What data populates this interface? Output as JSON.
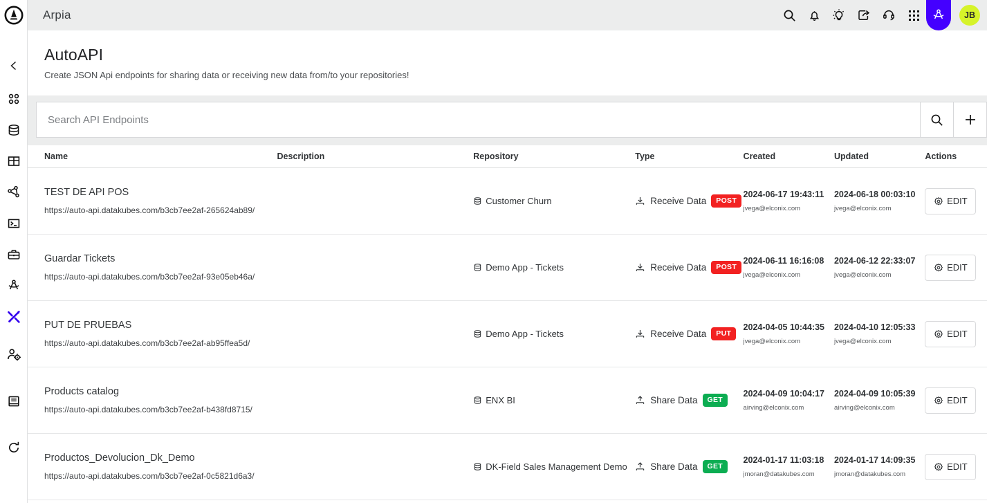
{
  "brand": {
    "logo_name": "arpia-logo",
    "accent": "#4400ff",
    "avatar_bg": "#d6f32a"
  },
  "topbar": {
    "title": "Arpia",
    "icons": [
      {
        "name": "search-icon"
      },
      {
        "name": "bell-icon"
      },
      {
        "name": "lightbulb-idea-icon"
      },
      {
        "name": "share-icon"
      },
      {
        "name": "headset-support-icon"
      },
      {
        "name": "apps-grid-icon"
      },
      {
        "name": "arpia-tools-icon",
        "active": true
      }
    ],
    "avatar_initials": "JB"
  },
  "sidebar": {
    "collapse_icon": "chevron-left-icon",
    "items": [
      {
        "name": "sidebar-item-dashboard",
        "icon": "four-dots-icon"
      },
      {
        "name": "sidebar-item-databases",
        "icon": "database-icon"
      },
      {
        "name": "sidebar-item-tables",
        "icon": "table-grid-icon"
      },
      {
        "name": "sidebar-item-pipelines",
        "icon": "network-share-icon"
      },
      {
        "name": "sidebar-item-terminal",
        "icon": "terminal-icon"
      },
      {
        "name": "sidebar-item-toolbox",
        "icon": "briefcase-icon"
      },
      {
        "name": "sidebar-item-autoapi",
        "icon": "arpia-compass-icon"
      },
      {
        "name": "sidebar-item-tools",
        "icon": "wrench-screwdriver-icon",
        "active": true
      },
      {
        "name": "sidebar-item-user-admin",
        "icon": "user-settings-icon"
      },
      {
        "name": "sidebar-item-docs",
        "icon": "book-icon"
      },
      {
        "name": "sidebar-item-refresh",
        "icon": "refresh-icon"
      }
    ]
  },
  "page": {
    "title": "AutoAPI",
    "subtitle": "Create JSON Api endpoints for sharing data or receiving new data from/to your repositories!"
  },
  "search": {
    "placeholder": "Search API Endpoints",
    "value": "",
    "search_icon": "search-icon",
    "add_icon": "plus-icon"
  },
  "table": {
    "columns": [
      {
        "key": "name",
        "label": "Name"
      },
      {
        "key": "description",
        "label": "Description"
      },
      {
        "key": "repository",
        "label": "Repository"
      },
      {
        "key": "type",
        "label": "Type"
      },
      {
        "key": "created",
        "label": "Created"
      },
      {
        "key": "updated",
        "label": "Updated"
      },
      {
        "key": "actions",
        "label": "Actions"
      }
    ],
    "edit_label": "EDIT",
    "rows": [
      {
        "name": "TEST DE API POS",
        "url": "https://auto-api.datakubes.com/b3cb7ee2af-265624ab89/",
        "description": "",
        "repository": "Customer Churn",
        "type_label": "Receive Data",
        "type_icon": "receive-data-icon",
        "method": "POST",
        "method_color": "#f22121",
        "created_at": "2024-06-17 19:43:11",
        "created_by": "jvega@elconix.com",
        "updated_at": "2024-06-18 00:03:10",
        "updated_by": "jvega@elconix.com"
      },
      {
        "name": "Guardar Tickets",
        "url": "https://auto-api.datakubes.com/b3cb7ee2af-93e05eb46a/",
        "description": "",
        "repository": "Demo App - Tickets",
        "type_label": "Receive Data",
        "type_icon": "receive-data-icon",
        "method": "POST",
        "method_color": "#f22121",
        "created_at": "2024-06-11 16:16:08",
        "created_by": "jvega@elconix.com",
        "updated_at": "2024-06-12 22:33:07",
        "updated_by": "jvega@elconix.com"
      },
      {
        "name": "PUT DE PRUEBAS",
        "url": "https://auto-api.datakubes.com/b3cb7ee2af-ab95ffea5d/",
        "description": "",
        "repository": "Demo App - Tickets",
        "type_label": "Receive Data",
        "type_icon": "receive-data-icon",
        "method": "PUT",
        "method_color": "#f22121",
        "created_at": "2024-04-05 10:44:35",
        "created_by": "jvega@elconix.com",
        "updated_at": "2024-04-10 12:05:33",
        "updated_by": "jvega@elconix.com"
      },
      {
        "name": "Products catalog",
        "url": "https://auto-api.datakubes.com/b3cb7ee2af-b438fd8715/",
        "description": "",
        "repository": "ENX BI",
        "type_label": "Share Data",
        "type_icon": "share-data-icon",
        "method": "GET",
        "method_color": "#0cad52",
        "created_at": "2024-04-09 10:04:17",
        "created_by": "airving@elconix.com",
        "updated_at": "2024-04-09 10:05:39",
        "updated_by": "airving@elconix.com"
      },
      {
        "name": "Productos_Devolucion_Dk_Demo",
        "url": "https://auto-api.datakubes.com/b3cb7ee2af-0c5821d6a3/",
        "description": "",
        "repository": "DK-Field Sales Management Demo",
        "type_label": "Share Data",
        "type_icon": "share-data-icon",
        "method": "GET",
        "method_color": "#0cad52",
        "created_at": "2024-01-17 11:03:18",
        "created_by": "jmoran@datakubes.com",
        "updated_at": "2024-01-17 14:09:35",
        "updated_by": "jmoran@datakubes.com"
      }
    ]
  }
}
